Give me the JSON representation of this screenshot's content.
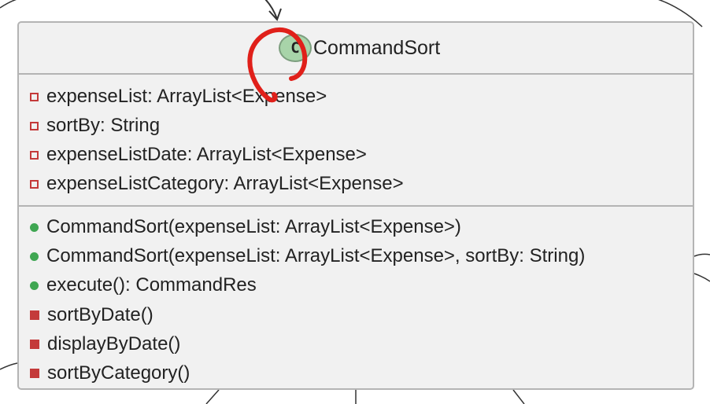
{
  "class": {
    "stereotype_letter": "C",
    "name": "CommandSort"
  },
  "fields": [
    {
      "visibility": "private",
      "text": "expenseList: ArrayList<Expense>"
    },
    {
      "visibility": "private",
      "text": "sortBy: String"
    },
    {
      "visibility": "private",
      "text": "expenseListDate: ArrayList<Expense>"
    },
    {
      "visibility": "private",
      "text": "expenseListCategory: ArrayList<Expense>"
    }
  ],
  "methods": [
    {
      "visibility": "public",
      "text": "CommandSort(expenseList: ArrayList<Expense>)"
    },
    {
      "visibility": "public",
      "text": "CommandSort(expenseList: ArrayList<Expense>, sortBy: String)"
    },
    {
      "visibility": "public",
      "text": "execute(): CommandRes"
    },
    {
      "visibility": "private",
      "text": "sortByDate()"
    },
    {
      "visibility": "private",
      "text": "displayByDate()"
    },
    {
      "visibility": "private",
      "text": "sortByCategory()"
    }
  ],
  "colors": {
    "box_fill": "#f1f1f1",
    "box_border": "#b4b4b4",
    "class_badge": "#a8d4a9",
    "private_marker": "#c43a3a",
    "public_marker": "#3fa652",
    "annotation_circle": "#e0201a"
  }
}
